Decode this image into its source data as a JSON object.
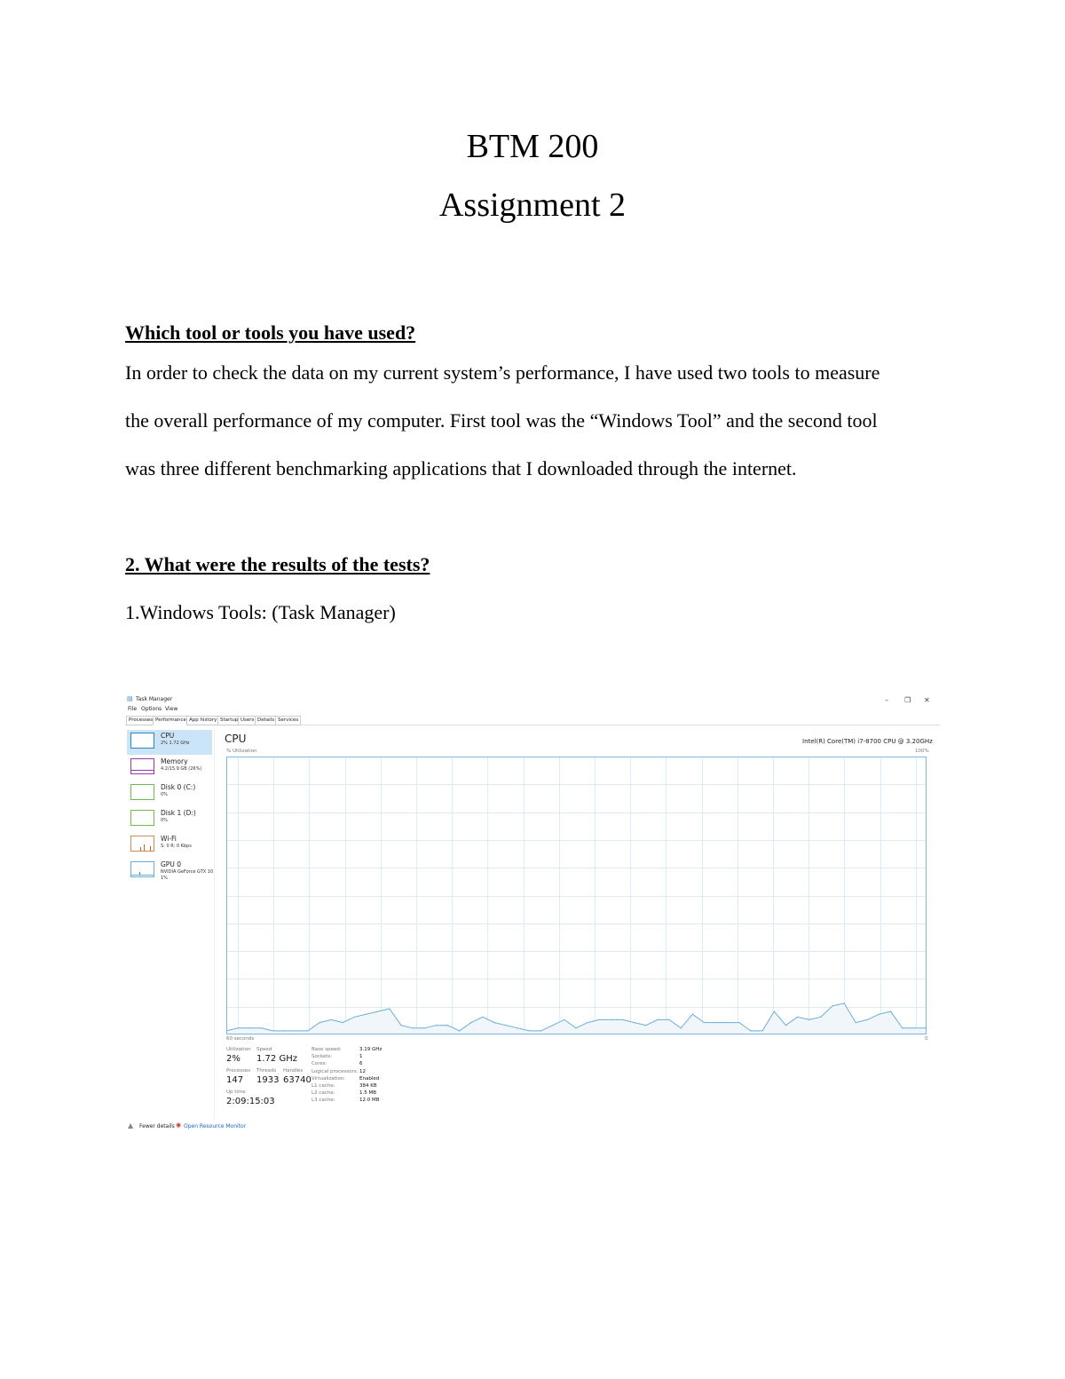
{
  "document": {
    "course": "BTM 200",
    "assignment": "Assignment 2",
    "q1_heading": "Which tool or tools you have used?",
    "q1_lines": [
      "In order to check the data on my current system’s performance, I have used two tools to measure",
      "the overall performance of my computer. First tool was the “Windows Tool” and the second tool",
      "was three different benchmarking applications that I downloaded through the internet."
    ],
    "q2_heading": "2. What were the results of the tests?",
    "q2_sub": "1.Windows Tools: (Task Manager)"
  },
  "task_manager": {
    "title": "Task Manager",
    "window_controls": {
      "minimize": "–",
      "restore": "❐",
      "close": "✕"
    },
    "menu": [
      "File",
      "Options",
      "View"
    ],
    "tabs": [
      "Processes",
      "Performance",
      "App history",
      "Startup",
      "Users",
      "Details",
      "Services"
    ],
    "active_tab": "Performance",
    "sidebar": [
      {
        "name": "CPU",
        "sub": "2% 1.72 GHz",
        "color": "#1e88c8",
        "active": true
      },
      {
        "name": "Memory",
        "sub": "4.2/15.9 GB (26%)",
        "color": "#9b38b8"
      },
      {
        "name": "Disk 0 (C:)",
        "sub": "0%",
        "color": "#4c9a2a"
      },
      {
        "name": "Disk 1 (D:)",
        "sub": "0%",
        "color": "#4c9a2a"
      },
      {
        "name": "Wi-Fi",
        "sub": "S: 0 R: 0 Kbps",
        "color": "#b8652a"
      },
      {
        "name": "GPU 0",
        "sub": "NVIDIA GeForce GTX 10",
        "sub2": "1%",
        "color": "#1e88c8"
      }
    ],
    "main": {
      "heading": "CPU",
      "processor": "Intel(R) Core(TM) i7-8700 CPU @ 3.20GHz",
      "y_label": "% Utilization",
      "y_max_label": "100%",
      "x_label_left": "60 seconds",
      "x_label_right": "0"
    },
    "stats": {
      "utilization_label": "Utilization",
      "utilization": "2%",
      "speed_label": "Speed",
      "speed": "1.72 GHz",
      "processes_label": "Processes",
      "processes": "147",
      "threads_label": "Threads",
      "threads": "1933",
      "handles_label": "Handles",
      "handles": "63740",
      "uptime_label": "Up time",
      "uptime": "2:09:15:03"
    },
    "specs": [
      {
        "k": "Base speed:",
        "v": "3.19 GHz"
      },
      {
        "k": "Sockets:",
        "v": "1"
      },
      {
        "k": "Cores:",
        "v": "6"
      },
      {
        "k": "Logical processors:",
        "v": "12"
      },
      {
        "k": "Virtualization:",
        "v": "Enabled"
      },
      {
        "k": "L1 cache:",
        "v": "384 KB"
      },
      {
        "k": "L2 cache:",
        "v": "1.5 MB"
      },
      {
        "k": "L3 cache:",
        "v": "12.0 MB"
      }
    ],
    "footer": {
      "fewer_details": "Fewer details",
      "open_resource_monitor": "Open Resource Monitor"
    },
    "colors": {
      "graph_line": "#6aaed6",
      "graph_fill": "#f1f6fa",
      "grid": "#dcebf6",
      "border": "#7db8dc"
    }
  },
  "chart_data": {
    "type": "area",
    "title": "CPU",
    "ylabel": "% Utilization",
    "xlabel": "60 seconds",
    "ylim": [
      0,
      100
    ],
    "x": [
      60,
      59,
      58,
      57,
      56,
      55,
      54,
      53,
      52,
      51,
      50,
      49,
      48,
      47,
      46,
      45,
      44,
      43,
      42,
      41,
      40,
      39,
      38,
      37,
      36,
      35,
      34,
      33,
      32,
      31,
      30,
      29,
      28,
      27,
      26,
      25,
      24,
      23,
      22,
      21,
      20,
      19,
      18,
      17,
      16,
      15,
      14,
      13,
      12,
      11,
      10,
      9,
      8,
      7,
      6,
      5,
      4,
      3,
      2,
      1,
      0
    ],
    "values": [
      1,
      2,
      2,
      2,
      1,
      1,
      1,
      1,
      4,
      5,
      4,
      6,
      7,
      8,
      9,
      3,
      2,
      2,
      3,
      3,
      1,
      4,
      6,
      4,
      3,
      2,
      1,
      1,
      3,
      5,
      2,
      4,
      5,
      5,
      5,
      4,
      3,
      5,
      5,
      2,
      7,
      4,
      4,
      4,
      4,
      1,
      1,
      8,
      3,
      6,
      5,
      6,
      10,
      11,
      4,
      5,
      7,
      8,
      2,
      2,
      2
    ],
    "grid": true
  }
}
